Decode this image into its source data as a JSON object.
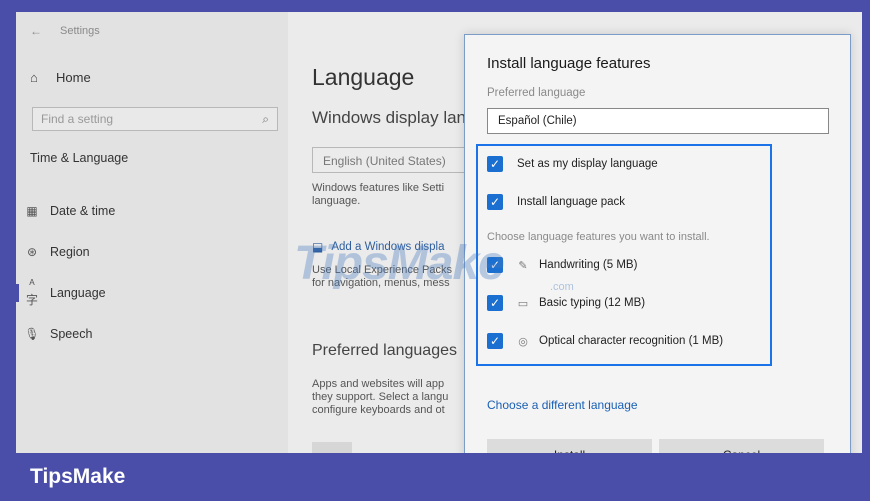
{
  "window": {
    "title": "Settings",
    "back_glyph": "←"
  },
  "sidebar": {
    "home_label": "Home",
    "search_placeholder": "Find a setting",
    "section_label": "Time & Language",
    "items": [
      {
        "label": "Date & time",
        "icon": "calendar-clock-icon"
      },
      {
        "label": "Region",
        "icon": "globe-icon"
      },
      {
        "label": "Language",
        "icon": "language-icon",
        "active": true
      },
      {
        "label": "Speech",
        "icon": "microphone-icon"
      }
    ]
  },
  "main": {
    "title": "Language",
    "display_heading": "Windows display lan",
    "display_value": "English (United States)",
    "para1_line1": "Windows features like Setti",
    "para1_line2": "language.",
    "add_link": "Add a Windows displa",
    "para2_line1": "Use Local Experience Packs",
    "para2_line2": "for navigation, menus, mess",
    "preferred_heading": "Preferred languages",
    "para3_line1": "Apps and websites will app",
    "para3_line2": "they support. Select a langu",
    "para3_line3": "configure keyboards and ot"
  },
  "dialog": {
    "title": "Install language features",
    "preferred_label": "Preferred language",
    "preferred_value": "Español (Chile)",
    "options": [
      {
        "label": "Set as my display language",
        "checked": true
      },
      {
        "label": "Install language pack",
        "checked": true
      }
    ],
    "features_hint": "Choose language features you want to install.",
    "features": [
      {
        "label": "Handwriting (5 MB)",
        "icon": "handwriting-icon",
        "checked": true
      },
      {
        "label": "Basic typing (12 MB)",
        "icon": "keyboard-icon",
        "checked": true
      },
      {
        "label": "Optical character recognition (1 MB)",
        "icon": "ocr-icon",
        "checked": true
      }
    ],
    "different_language_link": "Choose a different language",
    "install_label": "Install",
    "cancel_label": "Cancel"
  },
  "watermark": {
    "text": "TipsMake",
    "sub": ".com"
  },
  "footer": {
    "brand": "TipsMake"
  },
  "colors": {
    "accent": "#1a6fd0",
    "brand_bar": "#4a4ea8",
    "link": "#2f5e9e"
  }
}
